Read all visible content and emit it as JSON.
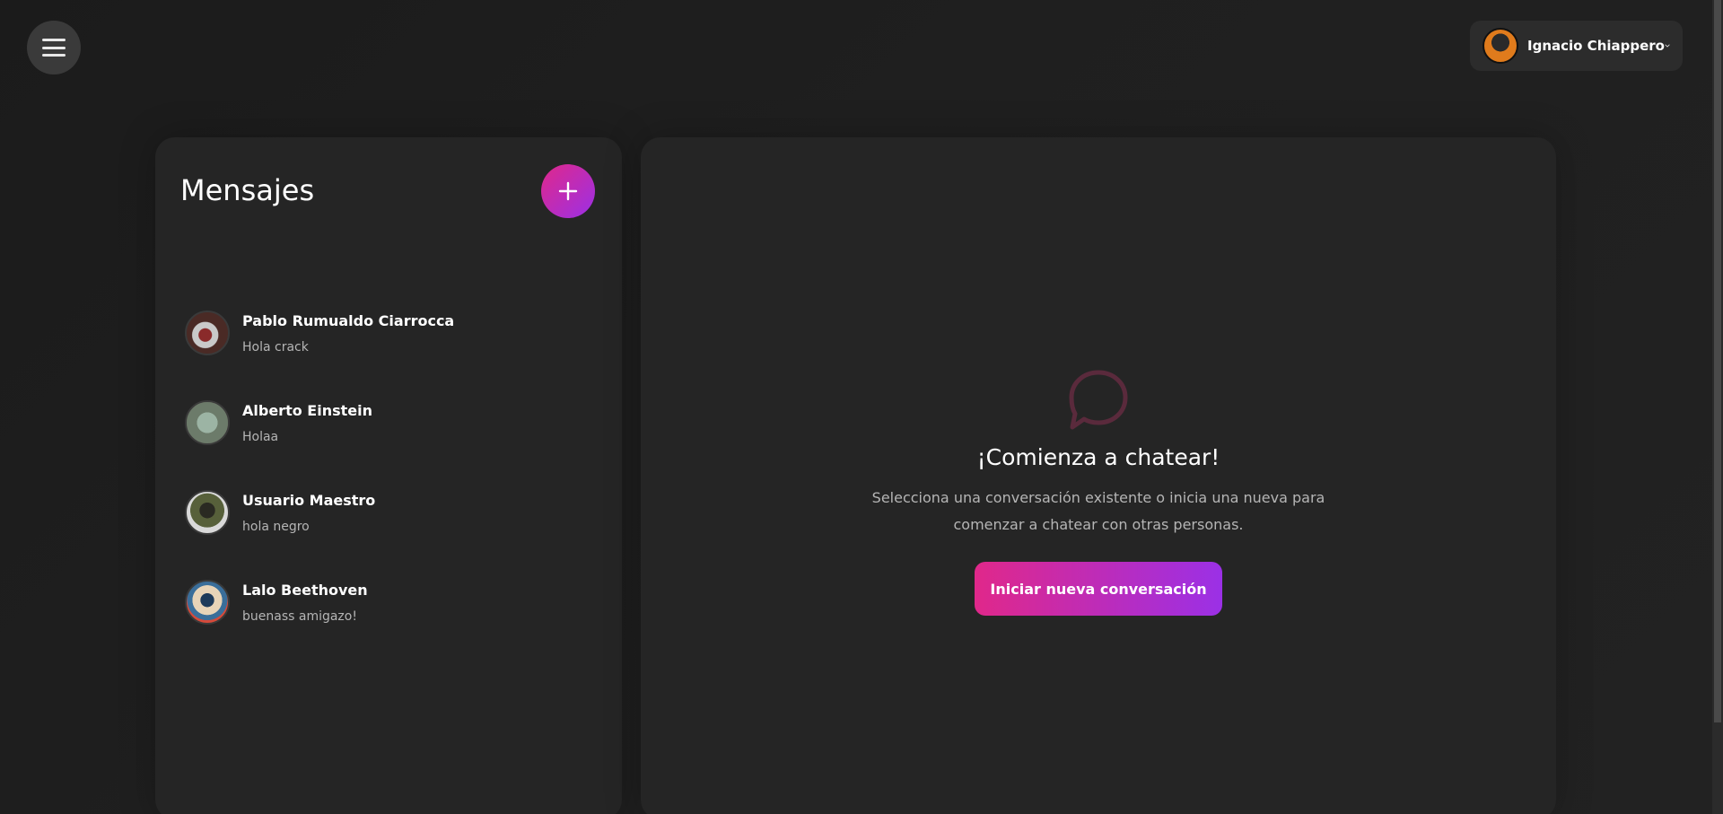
{
  "header": {
    "menu_icon": "hamburger-menu-icon",
    "user": {
      "name": "Ignacio Chiappero",
      "chevron_icon": "chevron-down-icon"
    }
  },
  "messages_panel": {
    "title": "Mensajes",
    "add_icon": "plus-icon",
    "conversations": [
      {
        "name": "Pablo Rumualdo Ciarrocca",
        "last_message": "Hola crack"
      },
      {
        "name": "Alberto Einstein",
        "last_message": "Holaa"
      },
      {
        "name": "Usuario Maestro",
        "last_message": "hola negro"
      },
      {
        "name": "Lalo Beethoven",
        "last_message": "buenass amigazo!"
      }
    ]
  },
  "chat_panel": {
    "icon": "chat-bubble-icon",
    "title": "¡Comienza a chatear!",
    "description": "Selecciona una conversación existente o inicia una nueva para comenzar a chatear con otras personas.",
    "start_button_label": "Iniciar nueva conversación"
  },
  "colors": {
    "accent_start": "#e0288a",
    "accent_end": "#9b30e6",
    "background": "#1c1c1c",
    "panel": "#252525"
  }
}
